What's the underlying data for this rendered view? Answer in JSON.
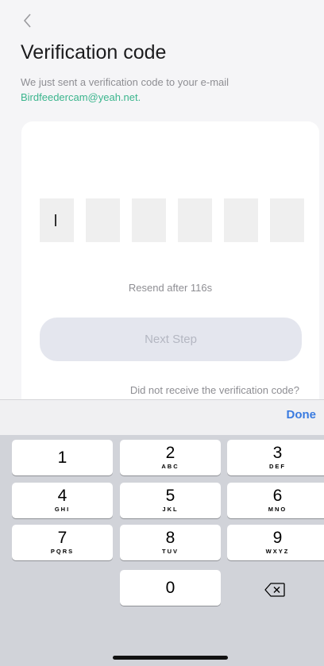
{
  "header": {
    "title": "Verification code",
    "subtitle": "We just sent a verification code to your e-mail",
    "email": "Birdfeedercam@yeah.net."
  },
  "card": {
    "code_digits": [
      "",
      "",
      "",
      "",
      "",
      ""
    ],
    "resend": "Resend after 116s",
    "next_label": "Next Step",
    "no_code": "Did not receive the verification code?"
  },
  "accessory": {
    "done_label": "Done"
  },
  "keyboard": {
    "keys": [
      {
        "digit": "1",
        "letters": ""
      },
      {
        "digit": "2",
        "letters": "ABC"
      },
      {
        "digit": "3",
        "letters": "DEF"
      },
      {
        "digit": "4",
        "letters": "GHI"
      },
      {
        "digit": "5",
        "letters": "JKL"
      },
      {
        "digit": "6",
        "letters": "MNO"
      },
      {
        "digit": "7",
        "letters": "PQRS"
      },
      {
        "digit": "8",
        "letters": "TUV"
      },
      {
        "digit": "9",
        "letters": "WXYZ"
      },
      {
        "digit": "0",
        "letters": ""
      }
    ]
  },
  "icons": {
    "back": "chevron-left-icon",
    "delete": "backspace-icon"
  },
  "colors": {
    "email_accent": "#3bb58d",
    "done_blue": "#3a7be0",
    "button_disabled": "#e4e6ee"
  }
}
